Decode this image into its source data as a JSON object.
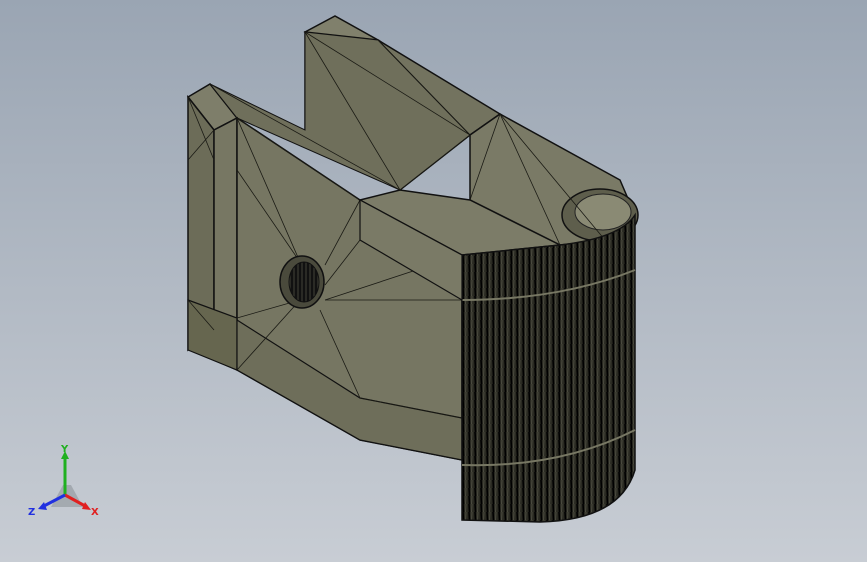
{
  "viewport": {
    "background_top": "#9aa5b3",
    "background_bottom": "#c8cdd4"
  },
  "model": {
    "face_color": "#73735f",
    "face_light": "#80806c",
    "face_dark": "#63634f",
    "edge_color": "#111111"
  },
  "triad": {
    "x_label": "X",
    "y_label": "Y",
    "z_label": "Z",
    "x_color": "#e02020",
    "y_color": "#20b020",
    "z_color": "#2030e0"
  }
}
